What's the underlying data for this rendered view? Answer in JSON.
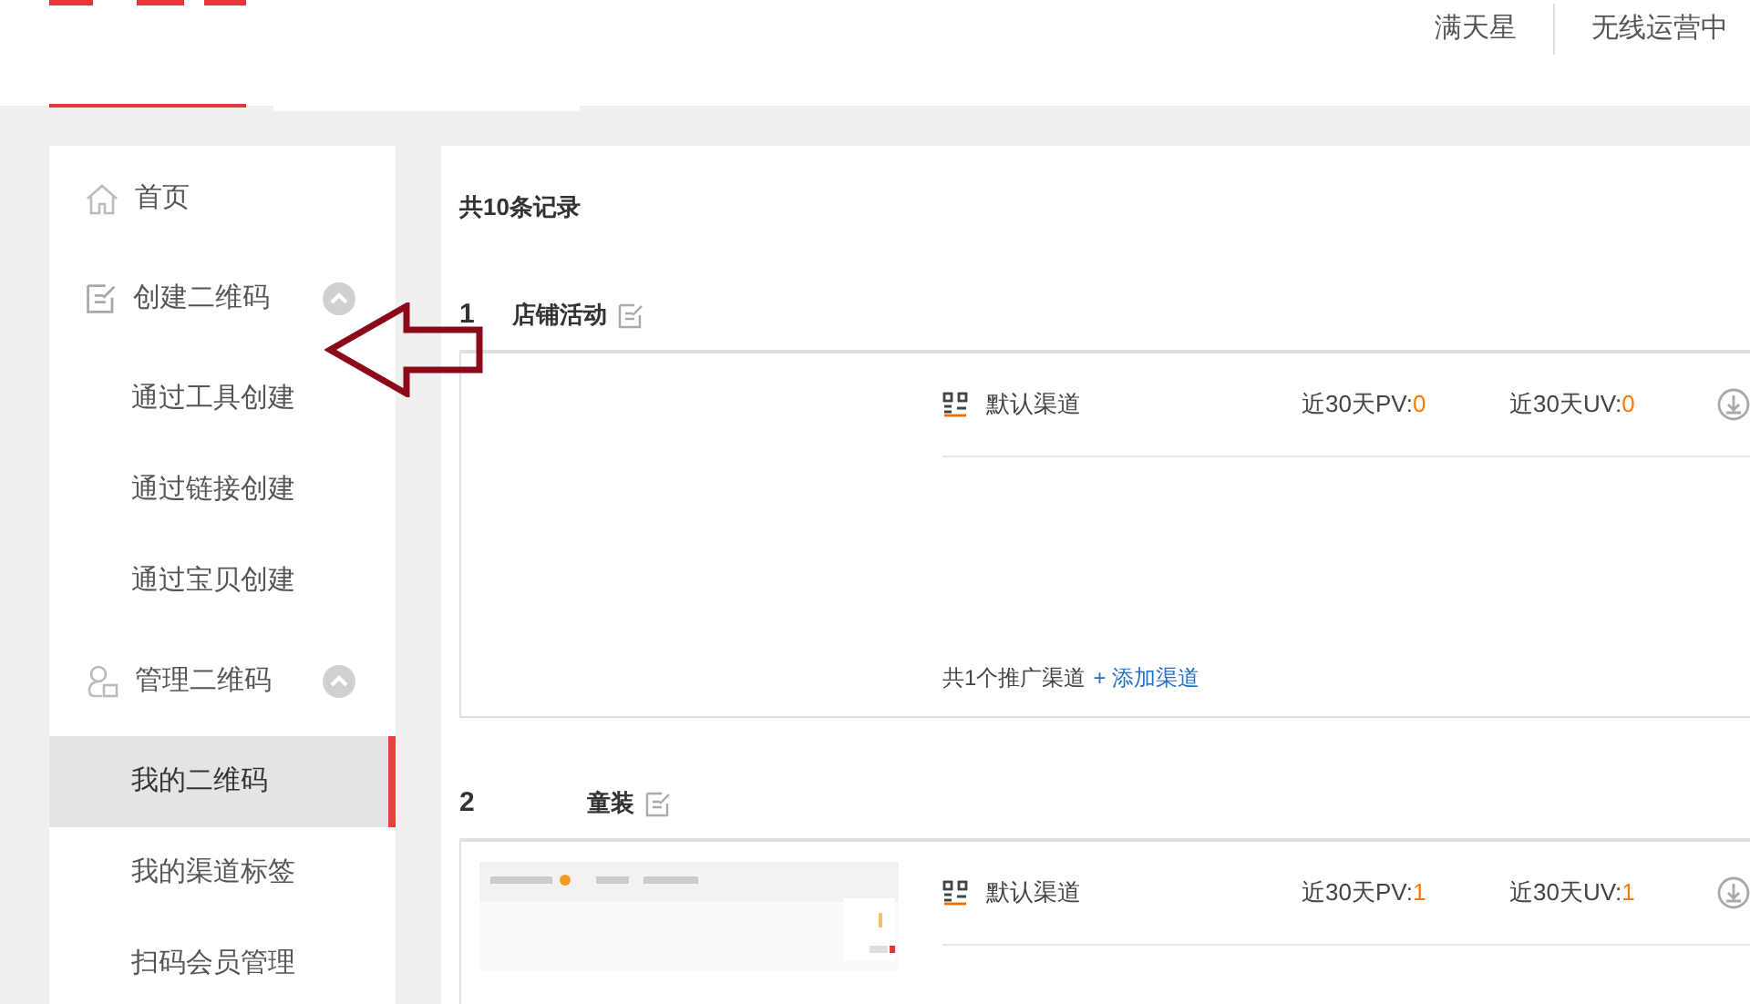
{
  "header": {
    "nav": [
      "满天星",
      "无线运营中"
    ]
  },
  "sidebar": {
    "home": {
      "label": "首页"
    },
    "groups": [
      {
        "label": "创建二维码",
        "expanded": true,
        "children": [
          {
            "label": "通过工具创建",
            "selected": false
          },
          {
            "label": "通过链接创建",
            "selected": false
          },
          {
            "label": "通过宝贝创建",
            "selected": false
          }
        ]
      },
      {
        "label": "管理二维码",
        "expanded": true,
        "children": [
          {
            "label": "我的二维码",
            "selected": true
          },
          {
            "label": "我的渠道标签",
            "selected": false
          },
          {
            "label": "扫码会员管理",
            "selected": false
          }
        ]
      }
    ]
  },
  "main": {
    "total": "共10条记录",
    "records": [
      {
        "number": "1",
        "name": "店铺活动",
        "channels": [
          {
            "name": "默认渠道",
            "pv_label": "近30天PV:",
            "pv": "0",
            "uv_label": "近30天UV:",
            "uv": "0"
          }
        ],
        "footer": {
          "summary": "共1个推广渠道",
          "add_link": "+ 添加渠道"
        }
      },
      {
        "number": "2",
        "name": "童装",
        "thumbnail": {
          "kind": "picture"
        },
        "channels": [
          {
            "name": "默认渠道",
            "pv_label": "近30天PV:",
            "pv": "1",
            "uv_label": "近30天UV:",
            "uv": "1"
          }
        ]
      }
    ]
  }
}
